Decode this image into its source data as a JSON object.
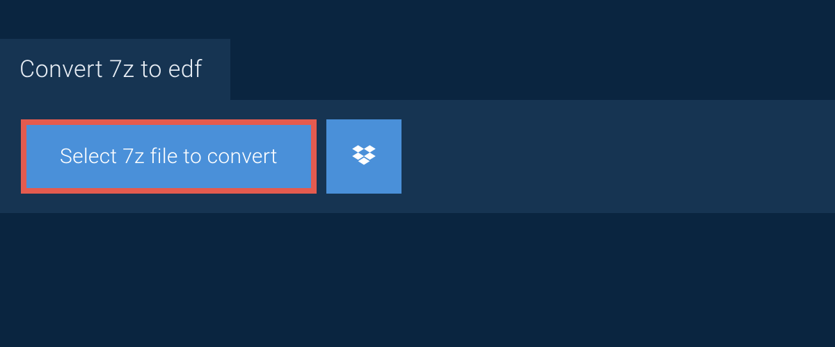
{
  "header": {
    "title": "Convert 7z to edf"
  },
  "actions": {
    "select_file_label": "Select 7z file to convert",
    "dropbox_icon": "dropbox"
  },
  "colors": {
    "background": "#0a2540",
    "panel": "#163452",
    "button_primary": "#4a90d9",
    "highlight_border": "#e45b4f"
  }
}
